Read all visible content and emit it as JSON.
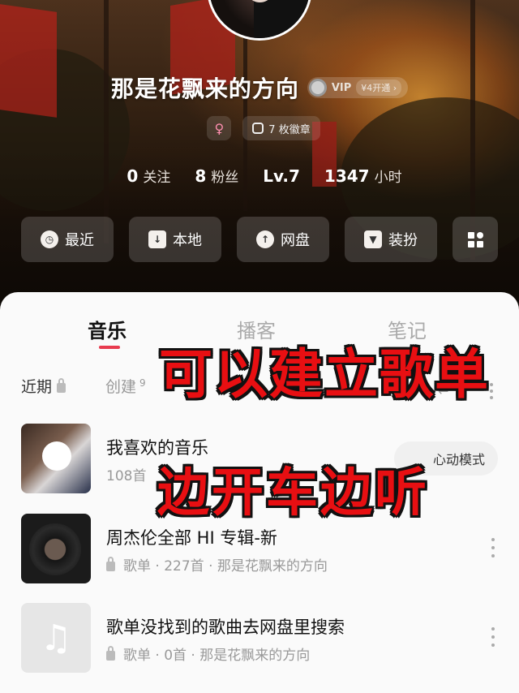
{
  "profile": {
    "username": "那是花飘来的方向",
    "vip_label": "VIP",
    "vip_price": "¥4开通 ›",
    "gender_symbol": "♀",
    "medal_label": "7 枚徽章",
    "stats": [
      {
        "num": "0",
        "label": "关注"
      },
      {
        "num": "8",
        "label": "粉丝"
      },
      {
        "num": "Lv.7",
        "label": ""
      },
      {
        "num": "1347",
        "label": "小时"
      }
    ]
  },
  "quick_buttons": [
    {
      "label": "最近",
      "icon": "clock-icon"
    },
    {
      "label": "本地",
      "icon": "download-icon"
    },
    {
      "label": "网盘",
      "icon": "cloud-upload-icon"
    },
    {
      "label": "装扮",
      "icon": "shirt-icon"
    },
    {
      "label": "",
      "icon": "grid-icon"
    }
  ],
  "tabs": [
    {
      "label": "音乐",
      "active": true
    },
    {
      "label": "播客",
      "active": false
    },
    {
      "label": "笔记",
      "active": false
    }
  ],
  "subtabs": {
    "recent": "近期",
    "created": "创建",
    "created_count": "9"
  },
  "playlists": [
    {
      "title": "我喜欢的音乐",
      "meta": "108首",
      "heart_mode": "心动模式"
    },
    {
      "title": "周杰伦全部 HI 专辑-新",
      "meta": "歌单 · 227首 · 那是花飘来的方向"
    },
    {
      "title": "歌单没找到的歌曲去网盘里搜索",
      "meta": "歌单 · 0首 · 那是花飘来的方向"
    }
  ],
  "captions": {
    "line1": "可以建立歌单",
    "line2": "边开车边听"
  },
  "colors": {
    "accent": "#e83a4e",
    "caption_red": "#e80f12"
  }
}
